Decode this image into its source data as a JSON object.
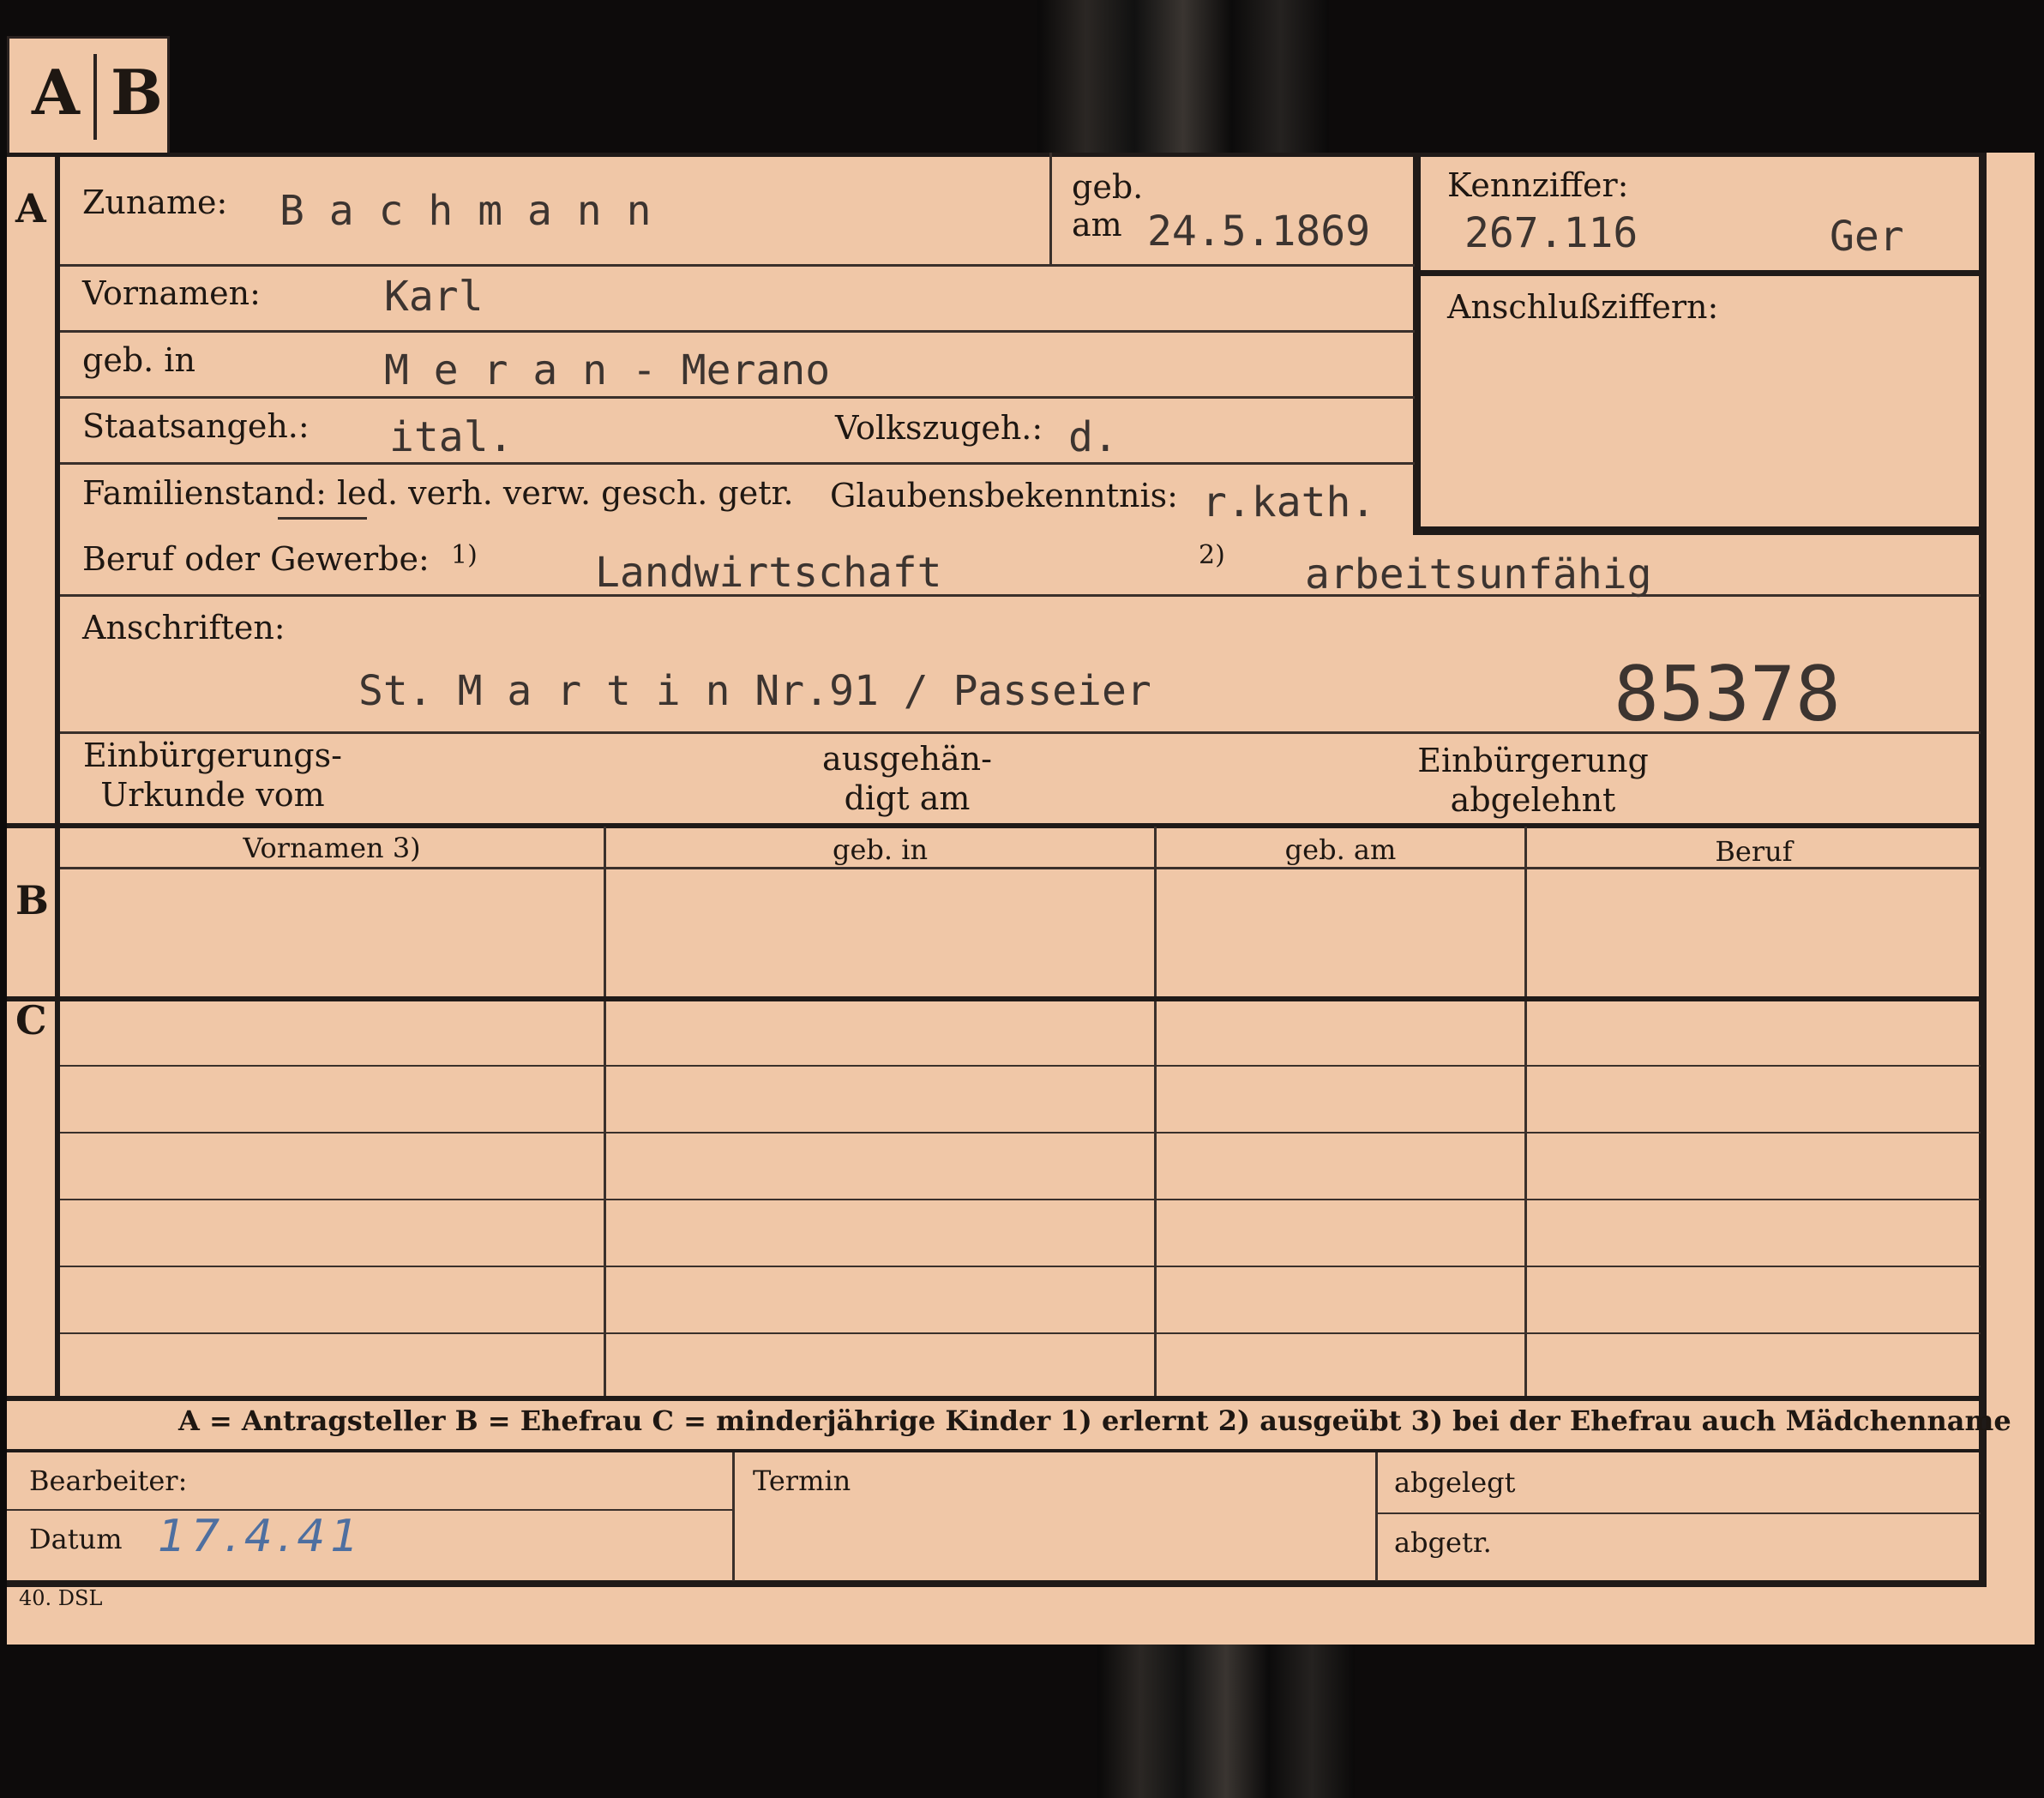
{
  "card": {
    "tab_a": "A",
    "tab_b": "B",
    "section_a": "A",
    "section_b": "B",
    "section_c": "C",
    "surname_label": "Zuname:",
    "surname_value": "B a c h m a n n",
    "born_label_1": "geb.",
    "born_label_2": "am",
    "born_value": "24.5.1869",
    "kennziffer_label": "Kennziffer:",
    "kennziffer_value": "267.116",
    "kennziffer_code": "Ger",
    "anschluss_label": "Anschlußziffern:",
    "vornamen_label": "Vornamen:",
    "vornamen_value": "Karl",
    "birthplace_label": "geb. in",
    "birthplace_value": "M e r a n - Merano",
    "citizenship_label": "Staatsangeh.:",
    "citizenship_value": "ital.",
    "ethnicity_label": "Volkszugeh.:",
    "ethnicity_value": "d.",
    "family_label": "Familienstand: led. verh. verw. gesch. getr.",
    "religion_label": "Glaubensbekenntnis:",
    "religion_value": "r.kath.",
    "occupation_label": "Beruf oder Gewerbe:",
    "note1": "1)",
    "occupation_value_1": "Landwirtschaft",
    "note2": "2)",
    "occupation_value_2": "arbeitsunfähig",
    "address_label": "Anschriften:",
    "address_value": "St. M a r t i n Nr.91 / Passeier",
    "stamp_number": "85378",
    "naturalization_doc_label": "Einbürgerungs-\nUrkunde vom",
    "handed_label": "ausgehän-\ndigt am",
    "naturalization_denied_label": "Einbürgerung\nabgelehnt",
    "table_headers": [
      "Vornamen 3)",
      "geb. in",
      "geb. am",
      "Beruf"
    ],
    "legend": "A = Antragsteller   B = Ehefrau   C = minderjährige Kinder   1) erlernt   2) ausgeübt   3) bei der Ehefrau auch Mädchenname",
    "clerk_label": "Bearbeiter:",
    "date_label": "Datum",
    "date_value": "17.4.41",
    "termin_label": "Termin",
    "filed_label": "abgelegt",
    "sent_label": "abgetr.",
    "print_mark": "40. DSL"
  }
}
